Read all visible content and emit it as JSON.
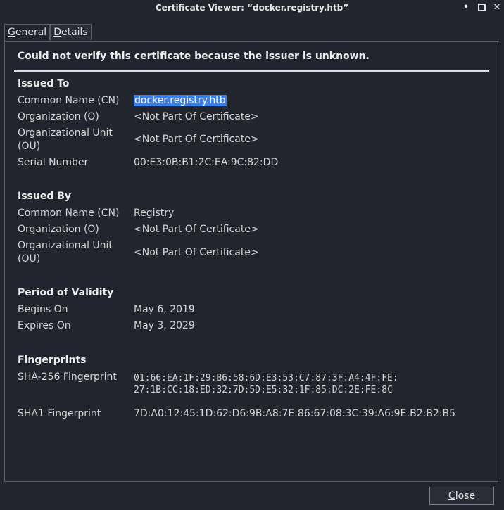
{
  "window": {
    "title": "Certificate Viewer: “docker.registry.htb”",
    "minimize_glyph": "•",
    "maximize_glyph": "■",
    "close_glyph": "✕"
  },
  "tabs": [
    {
      "label_first": "G",
      "label_rest": "eneral",
      "active": true
    },
    {
      "label_first": "D",
      "label_rest": "etails",
      "active": false
    }
  ],
  "warning": "Could not verify this certificate because the issuer is unknown.",
  "issued_to": {
    "title": "Issued To",
    "cn_label": "Common Name (CN)",
    "cn_value": "docker.registry.htb",
    "org_label": "Organization (O)",
    "org_value": "<Not Part Of Certificate>",
    "ou_label_line1": "Organizational Unit",
    "ou_label_line2": "(OU)",
    "ou_value": "<Not Part Of Certificate>",
    "serial_label": "Serial Number",
    "serial_value": "00:E3:0B:B1:2C:EA:9C:82:DD"
  },
  "issued_by": {
    "title": "Issued By",
    "cn_label": "Common Name (CN)",
    "cn_value": "Registry",
    "org_label": "Organization (O)",
    "org_value": "<Not Part Of Certificate>",
    "ou_label_line1": "Organizational Unit",
    "ou_label_line2": "(OU)",
    "ou_value": "<Not Part Of Certificate>"
  },
  "validity": {
    "title": "Period of Validity",
    "begins_label": "Begins On",
    "begins_value": "May 6, 2019",
    "expires_label": "Expires On",
    "expires_value": "May 3, 2029"
  },
  "fingerprints": {
    "title": "Fingerprints",
    "sha256_label": "SHA-256 Fingerprint",
    "sha256_line1": "01:66:EA:1F:29:B6:58:6D:E3:53:C7:87:3F:A4:4F:FE:",
    "sha256_line2": "27:1B:CC:18:ED:32:7D:5D:E5:32:1F:85:DC:2E:FE:8C",
    "sha1_label": "SHA1 Fingerprint",
    "sha1_value": "7D:A0:12:45:1D:62:D6:9B:A8:7E:86:67:08:3C:39:A6:9E:B2:B2:B5"
  },
  "buttons": {
    "close_first": "C",
    "close_rest": "lose"
  }
}
